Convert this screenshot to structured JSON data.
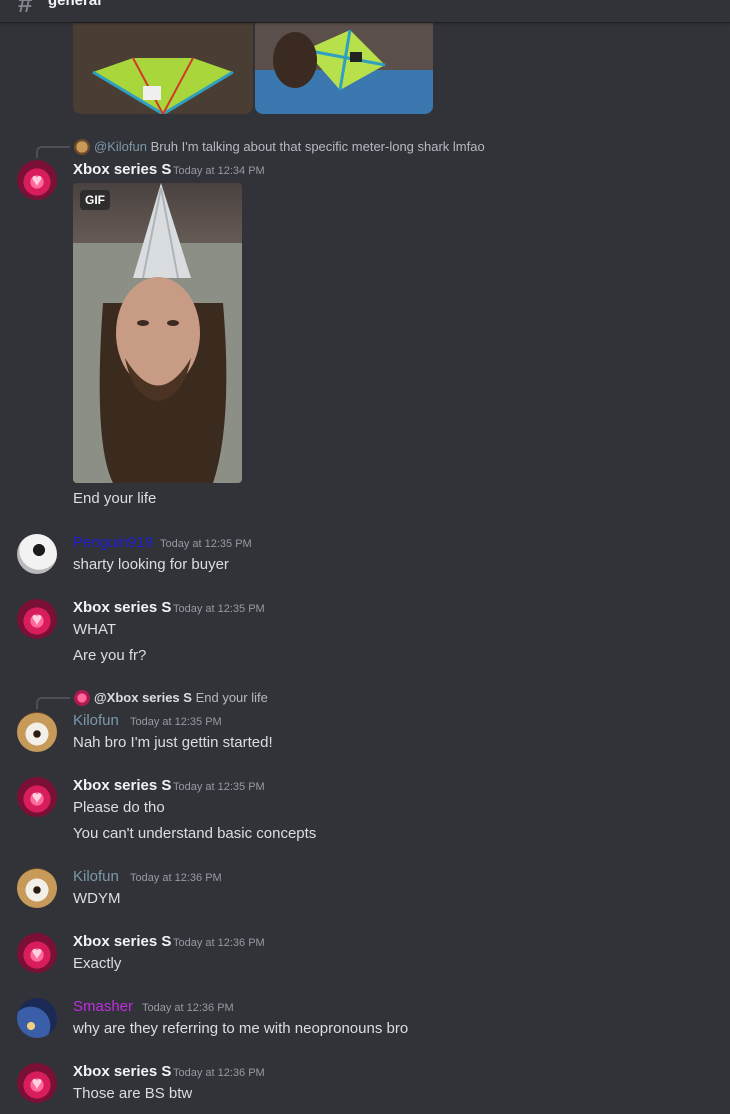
{
  "header": {
    "channel_icon": "hash-icon",
    "channel_name": "general"
  },
  "messages": [
    {
      "reply": {
        "author": "@Kilofun",
        "text": "Bruh I'm talking about that specific meter-long shark lmfao"
      },
      "author": "Xbox series S",
      "time": "Today at 12:34 PM",
      "gif_badge": "GIF",
      "text": "End your life"
    },
    {
      "author": "Penguin919",
      "time": "Today at 12:35 PM",
      "text": "sharty looking for buyer"
    },
    {
      "author": "Xbox series S",
      "time": "Today at 12:35 PM",
      "lines": [
        "WHAT",
        "Are you fr?"
      ]
    },
    {
      "reply": {
        "author": "@Xbox series S",
        "text": "End your life"
      },
      "author": "Kilofun",
      "time": "Today at 12:35 PM",
      "text": "Nah bro I'm just gettin started!"
    },
    {
      "author": "Xbox series S",
      "time": "Today at 12:35 PM",
      "lines": [
        "Please do tho",
        "You can't understand basic concepts"
      ]
    },
    {
      "author": "Kilofun",
      "time": "Today at 12:36 PM",
      "text": "WDYM"
    },
    {
      "author": "Xbox series S",
      "time": "Today at 12:36 PM",
      "text": "Exactly"
    },
    {
      "author": "Smasher",
      "time": "Today at 12:36 PM",
      "text": "why are they referring to me with neopronouns bro"
    },
    {
      "author": "Xbox series S",
      "time": "Today at 12:36 PM",
      "text": "Those are BS btw"
    }
  ],
  "colors": {
    "background": "#313338",
    "xbox_name": "#f2f3f5",
    "penguin_name": "#1f1fd6",
    "kilofun_name": "#7c98a8",
    "smasher_name": "#c02ee0",
    "timestamp": "#949ba4"
  }
}
